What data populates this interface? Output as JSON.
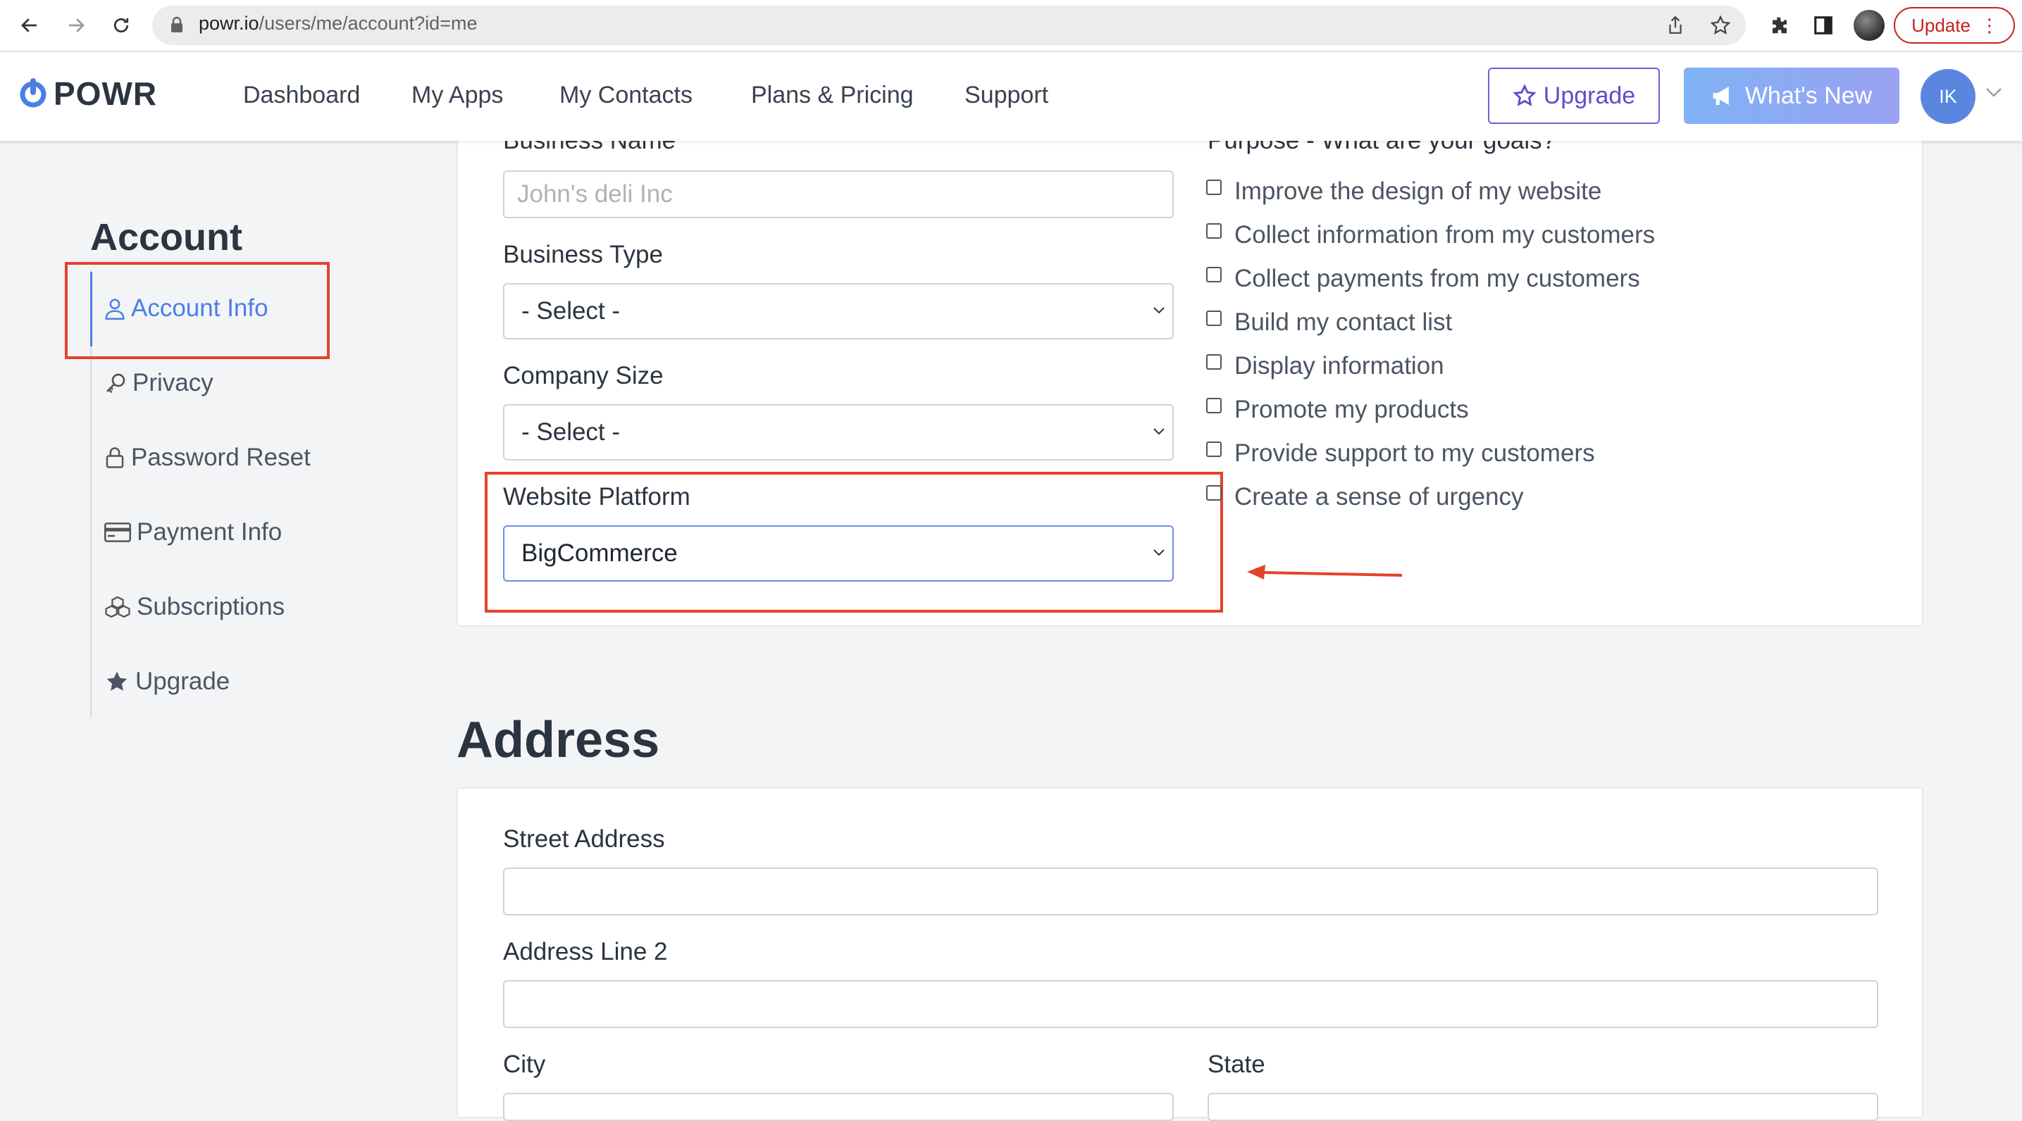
{
  "browser": {
    "url_host": "powr.io",
    "url_path": "/users/me/account?id=me",
    "update_label": "Update"
  },
  "header": {
    "logo_text": "POWR",
    "nav": [
      "Dashboard",
      "My Apps",
      "My Contacts",
      "Plans & Pricing",
      "Support"
    ],
    "upgrade_label": "Upgrade",
    "whats_new_label": "What's New",
    "avatar_initials": "IK"
  },
  "sidebar": {
    "title": "Account",
    "items": [
      {
        "label": "Account Info",
        "icon": "user-icon"
      },
      {
        "label": "Privacy",
        "icon": "key-icon"
      },
      {
        "label": "Password Reset",
        "icon": "lock-icon"
      },
      {
        "label": "Payment Info",
        "icon": "credit-card-icon"
      },
      {
        "label": "Subscriptions",
        "icon": "cubes-icon"
      },
      {
        "label": "Upgrade",
        "icon": "star-icon"
      }
    ]
  },
  "business": {
    "business_name_label": "Business Name",
    "business_name_placeholder": "John's deli Inc",
    "business_type_label": "Business Type",
    "business_type_value": "- Select -",
    "company_size_label": "Company Size",
    "company_size_value": "- Select -",
    "website_platform_label": "Website Platform",
    "website_platform_value": "BigCommerce",
    "purpose_label": "Purpose - What are your goals?",
    "purposes": [
      "Improve the design of my website",
      "Collect information from my customers",
      "Collect payments from my customers",
      "Build my contact list",
      "Display information",
      "Promote my products",
      "Provide support to my customers",
      "Create a sense of urgency"
    ]
  },
  "address": {
    "title": "Address",
    "street_label": "Street Address",
    "line2_label": "Address Line 2",
    "city_label": "City",
    "state_label": "State"
  },
  "colors": {
    "accent_blue": "#4a7fe6",
    "annotation_red": "#e4432a",
    "upgrade_purple": "#5b4fc9"
  }
}
